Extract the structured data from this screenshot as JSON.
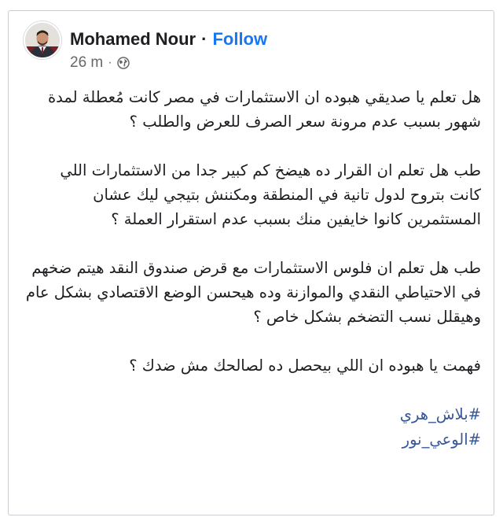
{
  "post": {
    "author": "Mohamed Nour",
    "separator": "·",
    "follow_label": "Follow",
    "time": "26 m",
    "meta_separator": "·",
    "privacy_icon": "globe-icon",
    "paragraphs": [
      "هل تعلم يا صديقي هبوده ان الاستثمارات في مصر كانت مُعطلة لمدة شهور بسبب عدم مرونة سعر الصرف للعرض والطلب ؟",
      "طب هل تعلم ان القرار ده هيضخ كم كبير جدا من الاستثمارات اللي كانت بتروح لدول تانية في المنطقة ومكننش بتيجي ليك عشان المستثمرين كانوا خايفين منك بسبب عدم استقرار العملة ؟",
      "طب هل تعلم ان فلوس الاستثمارات مع قرض صندوق النقد هيتم ضخهم في الاحتياطي النقدي والموازنة وده هيحسن الوضع الاقتصادي بشكل عام وهيقلل نسب التضخم بشكل خاص ؟",
      "فهمت يا هبوده ان اللي بيحصل ده لصالحك مش ضدك ؟"
    ],
    "hashtags": [
      "#بلاش_هري",
      "#الوعي_نور"
    ]
  },
  "colors": {
    "link": "#1877f2",
    "hashtag": "#385898",
    "text": "#1c1e21",
    "meta": "#65676b"
  }
}
